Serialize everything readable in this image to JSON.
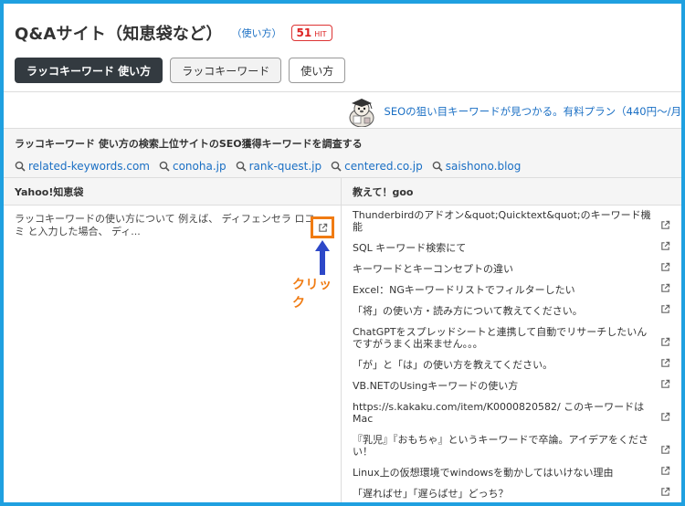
{
  "header": {
    "title": "Q&Aサイト（知恵袋など）",
    "howto_link": "（使い方）",
    "hit_count": "51",
    "hit_label": "HIT"
  },
  "buttons": [
    {
      "label": "ラッコキーワード 使い方",
      "active": true
    },
    {
      "label": "ラッコキーワード",
      "active": false
    },
    {
      "label": "使い方",
      "active": false
    }
  ],
  "promo": {
    "text": "SEOの狙い目キーワードが見つかる。有料プラン（440円〜/月"
  },
  "seo_section": {
    "title": "ラッコキーワード 使い方の検索上位サイトのSEO獲得キーワードを調査する",
    "sites": [
      "related-keywords.com",
      "conoha.jp",
      "rank-quest.jp",
      "centered.co.jp",
      "saishono.blog"
    ]
  },
  "left_column": {
    "header": "Yahoo!知恵袋",
    "items": [
      "ラッコキーワードの使い方について 例えば、 ディフェンセラ ロコミ と入力した場合、 ディ..."
    ]
  },
  "right_column": {
    "header": "教えて！goo",
    "items": [
      "Thunderbirdのアドオン&quot;Quicktext&quot;のキーワード機能",
      "SQL キーワード検索にて",
      "キーワードとキーコンセプトの違い",
      "Excel：NGキーワードリストでフィルターしたい",
      "「将」の使い方・読み方について教えてください。",
      "ChatGPTをスプレッドシートと連携して自動でリサーチしたいんですがうまく出来ません。。。",
      "「が」と「は」の使い方を教えてください。",
      "VB.NETのUsingキーワードの使い方",
      "https://s.kakaku.com/item/K0000820582/ このキーワードはMac",
      "『乳児』『おもちゃ』というキーワードで卒論。アイデアをください！",
      "Linux上の仮想環境でwindowsを動かしてはいけない理由",
      "「遅ればせ」「遅らばせ」どっち？"
    ]
  },
  "annotation": {
    "label": "クリック"
  },
  "colors": {
    "frame": "#1fa0e0",
    "link": "#1a6fc4",
    "accent": "#f07b12",
    "arrow": "#2d48c8",
    "hit_badge": "#dd2222"
  }
}
